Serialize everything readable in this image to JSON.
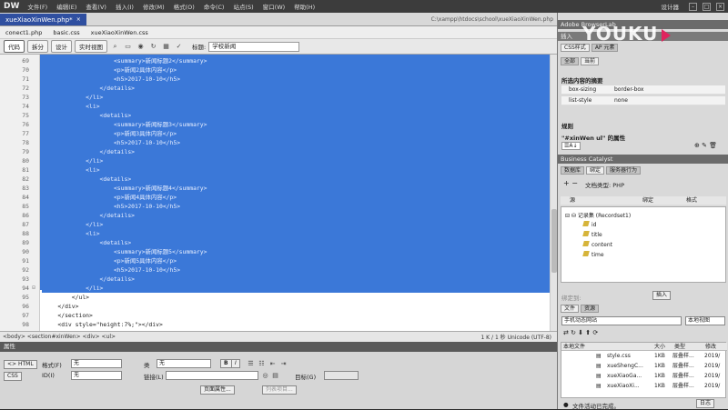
{
  "app": {
    "logo": "DW",
    "menu": [
      "文件(F)",
      "编辑(E)",
      "查看(V)",
      "插入(I)",
      "修改(M)",
      "格式(O)",
      "命令(C)",
      "站点(S)",
      "窗口(W)",
      "帮助(H)"
    ],
    "workspace": "设计器"
  },
  "document": {
    "tab_label": "xueXiaoXinWen.php*",
    "path": "C:\\xampp\\htdocs\\school\\xueXiaoXinWen.php",
    "related_files": [
      "conect1.php",
      "basic.css",
      "xueXiaoXinWen.css"
    ],
    "views": [
      "代码",
      "拆分",
      "设计",
      "实时视图"
    ],
    "title_label": "标题:",
    "title_value": "学校新闻"
  },
  "code_lines": [
    {
      "n": "69",
      "text": "                    <summary>新闻标题2</summary>",
      "sel": true
    },
    {
      "n": "70",
      "text": "                    <p>新闻2具体内容</p>",
      "sel": true
    },
    {
      "n": "71",
      "text": "                    <h5>2017-10-10</h5>",
      "sel": true
    },
    {
      "n": "72",
      "text": "                </details>",
      "sel": true
    },
    {
      "n": "73",
      "text": "            </li>",
      "sel": true
    },
    {
      "n": "74",
      "text": "            <li>",
      "sel": true
    },
    {
      "n": "75",
      "text": "                <details>",
      "sel": true
    },
    {
      "n": "76",
      "text": "                    <summary>新闻标题3</summary>",
      "sel": true
    },
    {
      "n": "77",
      "text": "                    <p>新闻3具体内容</p>",
      "sel": true
    },
    {
      "n": "78",
      "text": "                    <h5>2017-10-10</h5>",
      "sel": true
    },
    {
      "n": "79",
      "text": "                </details>",
      "sel": true
    },
    {
      "n": "80",
      "text": "            </li>",
      "sel": true
    },
    {
      "n": "81",
      "text": "            <li>",
      "sel": true
    },
    {
      "n": "82",
      "text": "                <details>",
      "sel": true
    },
    {
      "n": "83",
      "text": "                    <summary>新闻标题4</summary>",
      "sel": true
    },
    {
      "n": "84",
      "text": "                    <p>新闻4具体内容</p>",
      "sel": true
    },
    {
      "n": "85",
      "text": "                    <h5>2017-10-10</h5>",
      "sel": true
    },
    {
      "n": "86",
      "text": "                </details>",
      "sel": true
    },
    {
      "n": "87",
      "text": "            </li>",
      "sel": true
    },
    {
      "n": "88",
      "text": "            <li>",
      "sel": true
    },
    {
      "n": "89",
      "text": "                <details>",
      "sel": true
    },
    {
      "n": "90",
      "text": "                    <summary>新闻标题5</summary>",
      "sel": true
    },
    {
      "n": "91",
      "text": "                    <p>新闻5具体内容</p>",
      "sel": true
    },
    {
      "n": "92",
      "text": "                    <h5>2017-10-10</h5>",
      "sel": true
    },
    {
      "n": "93",
      "text": "                </details>",
      "sel": true
    },
    {
      "n": "94",
      "text": "            </li>",
      "sel": true
    },
    {
      "n": "95",
      "text": "        </ul>",
      "sel": false
    },
    {
      "n": "96",
      "text": "    </div>",
      "sel": false
    },
    {
      "n": "97",
      "text": "    </section>",
      "sel": false
    },
    {
      "n": "98",
      "text": "    <div style=\"height:7%;\"></div>",
      "sel": false
    }
  ],
  "status_bar": {
    "breadcrumb": "<body> <section#xinWen> <div> <ul>",
    "info": "1 K / 1 秒 Unicode (UTF-8)"
  },
  "properties": {
    "title": "属性",
    "html_btn": "<> HTML",
    "css_btn": "CSS",
    "format_label": "格式(F)",
    "format_value": "无",
    "class_label": "类",
    "class_value": "无",
    "id_label": "ID(I)",
    "id_value": "无",
    "link_label": "链接(L)",
    "target_label": "目标(G)",
    "page_props_btn": "页面属性...",
    "list_item_btn": "列表项目..."
  },
  "right_panel": {
    "browserlab": "Adobe BrowserLab",
    "insert": "插入",
    "css_tabs": [
      "CSS样式",
      "AP 元素"
    ],
    "css_subtabs": [
      "全部",
      "当前"
    ],
    "summary_title": "所选内容的摘要",
    "css_props": [
      [
        "box-sizing",
        "border-box"
      ],
      [
        "list-style",
        "none"
      ]
    ],
    "rules_title": "规则",
    "props_title": "\"#xinWen ul\" 的属性",
    "business_catalyst": "Business Catalyst",
    "data_tabs": [
      "数据库",
      "绑定",
      "服务器行为"
    ],
    "doc_type": "文档类型: PHP",
    "bind_cols": [
      "源",
      "绑定",
      "格式"
    ],
    "recordset": "记录集 (Recordset1)",
    "fields": [
      "id",
      "title",
      "content",
      "time"
    ],
    "bind_label": "绑定到:",
    "insert_btn": "插入",
    "file_tabs": [
      "文件",
      "资源"
    ],
    "site_select": "手机动态网站",
    "view_select": "本地视图",
    "file_cols": [
      "本地文件",
      "大小",
      "类型",
      "修改"
    ],
    "files": [
      [
        "style.css",
        "1KB",
        "层叠样...",
        "2019/"
      ],
      [
        "xueShengC...",
        "1KB",
        "层叠样...",
        "2019/"
      ],
      [
        "xueXiaoGa...",
        "1KB",
        "层叠样...",
        "2019/"
      ],
      [
        "xueXiaoXi...",
        "1KB",
        "层叠样...",
        "2019/"
      ]
    ],
    "log_text": "文件活动已完成。",
    "log_btn": "日志"
  },
  "watermark": "YOUKU"
}
